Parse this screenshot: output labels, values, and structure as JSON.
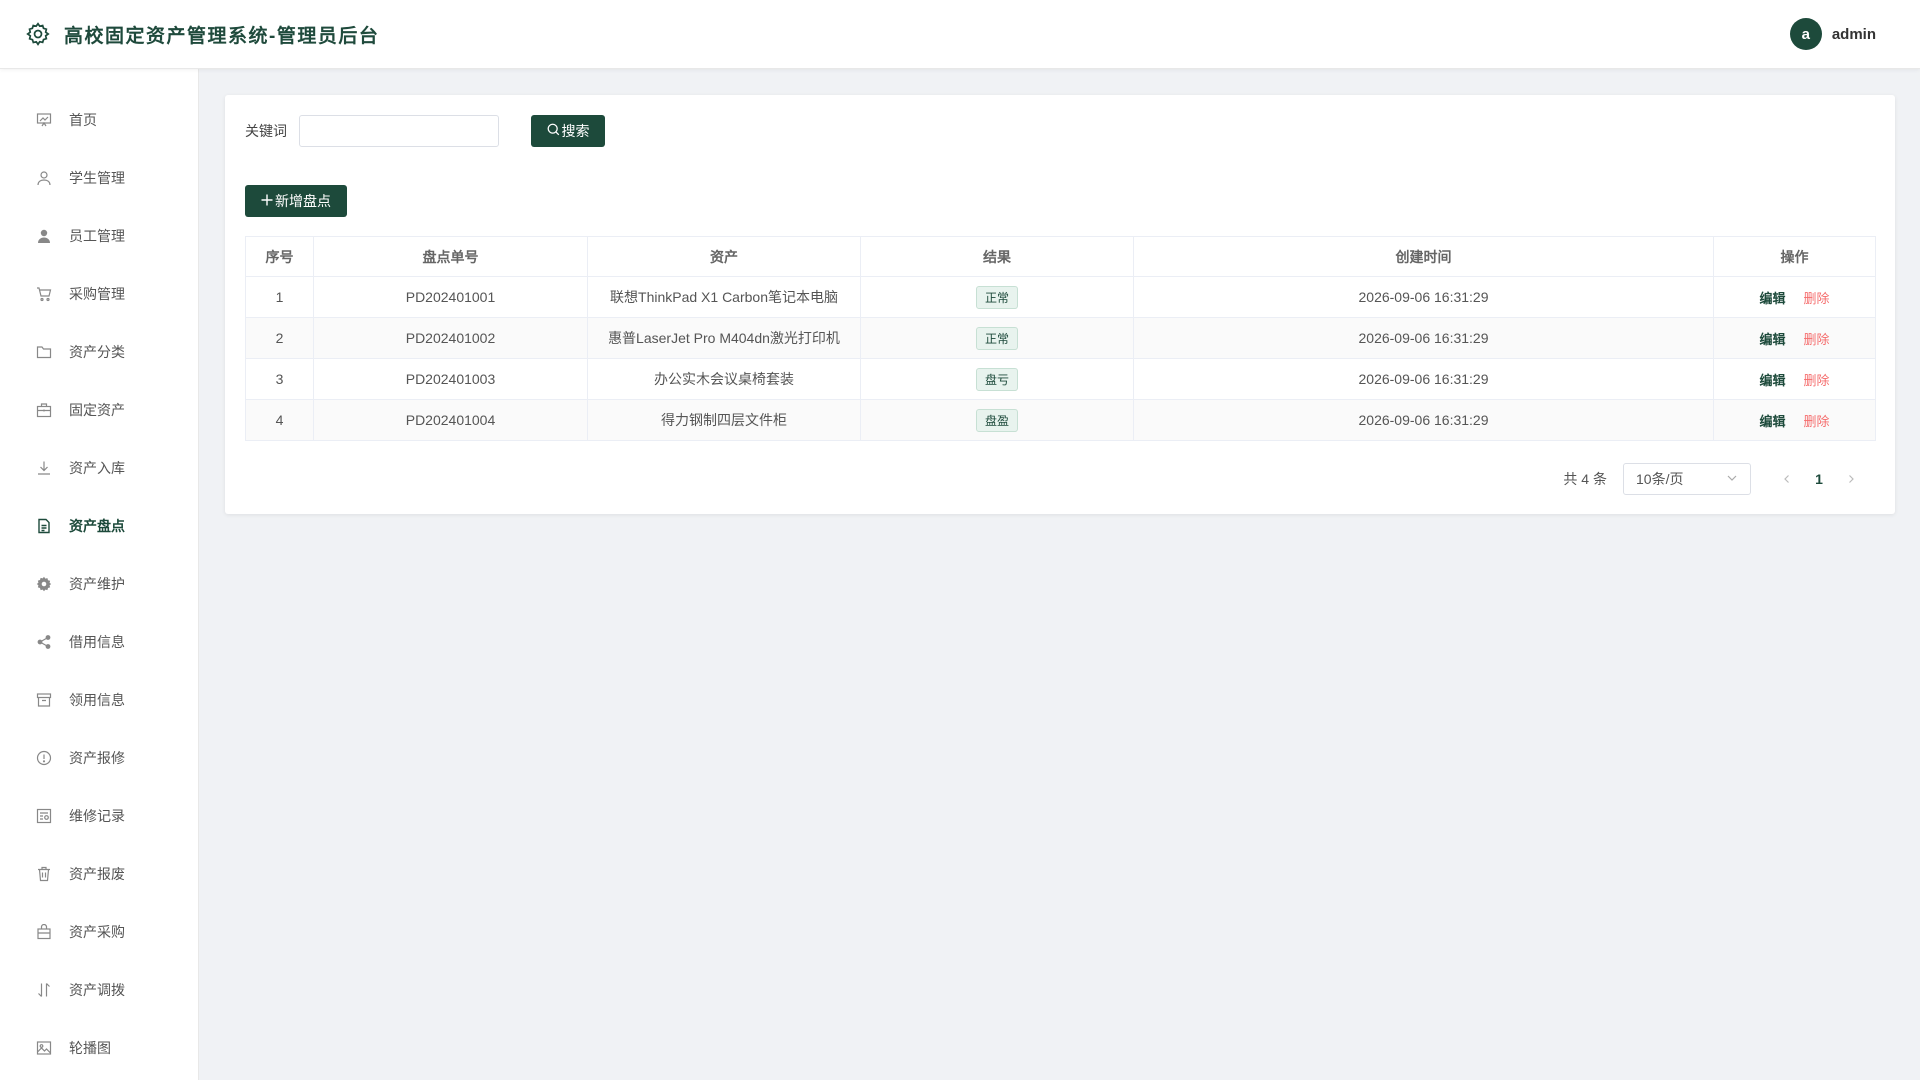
{
  "header": {
    "title": "高校固定资产管理系统-管理员后台",
    "avatar_letter": "a",
    "username": "admin"
  },
  "sidebar": {
    "items": [
      {
        "label": "首页",
        "icon": "chart-icon"
      },
      {
        "label": "学生管理",
        "icon": "user-outline-icon"
      },
      {
        "label": "员工管理",
        "icon": "user-filled-icon"
      },
      {
        "label": "采购管理",
        "icon": "cart-icon"
      },
      {
        "label": "资产分类",
        "icon": "folder-icon"
      },
      {
        "label": "固定资产",
        "icon": "briefcase-icon"
      },
      {
        "label": "资产入库",
        "icon": "download-icon"
      },
      {
        "label": "资产盘点",
        "icon": "document-icon",
        "active": true
      },
      {
        "label": "资产维护",
        "icon": "gear-icon"
      },
      {
        "label": "借用信息",
        "icon": "share-icon"
      },
      {
        "label": "领用信息",
        "icon": "box-icon"
      },
      {
        "label": "资产报修",
        "icon": "warning-icon"
      },
      {
        "label": "维修记录",
        "icon": "record-icon"
      },
      {
        "label": "资产报废",
        "icon": "trash-icon"
      },
      {
        "label": "资产采购",
        "icon": "bag-icon"
      },
      {
        "label": "资产调拨",
        "icon": "sort-icon"
      },
      {
        "label": "轮播图",
        "icon": "picture-icon"
      }
    ]
  },
  "search": {
    "label": "关键词",
    "value": "",
    "placeholder": "",
    "button_label": "搜索"
  },
  "toolbar": {
    "add_label": "新增盘点"
  },
  "table": {
    "columns": [
      "序号",
      "盘点单号",
      "资产",
      "结果",
      "创建时间",
      "操作"
    ],
    "rows": [
      {
        "index": "1",
        "code": "PD202401001",
        "asset": "联想ThinkPad X1 Carbon笔记本电脑",
        "result": "正常",
        "created": "2026-09-06 16:31:29"
      },
      {
        "index": "2",
        "code": "PD202401002",
        "asset": "惠普LaserJet Pro M404dn激光打印机",
        "result": "正常",
        "created": "2026-09-06 16:31:29"
      },
      {
        "index": "3",
        "code": "PD202401003",
        "asset": "办公实木会议桌椅套装",
        "result": "盘亏",
        "created": "2026-09-06 16:31:29"
      },
      {
        "index": "4",
        "code": "PD202401004",
        "asset": "得力钢制四层文件柜",
        "result": "盘盈",
        "created": "2026-09-06 16:31:29"
      }
    ],
    "edit_label": "编辑",
    "delete_label": "删除"
  },
  "pagination": {
    "total_text": "共 4 条",
    "page_size": "10条/页",
    "current_page": "1"
  },
  "colors": {
    "primary": "#1d4a3b",
    "danger": "#f56c6c",
    "background": "#f0f2f5"
  }
}
